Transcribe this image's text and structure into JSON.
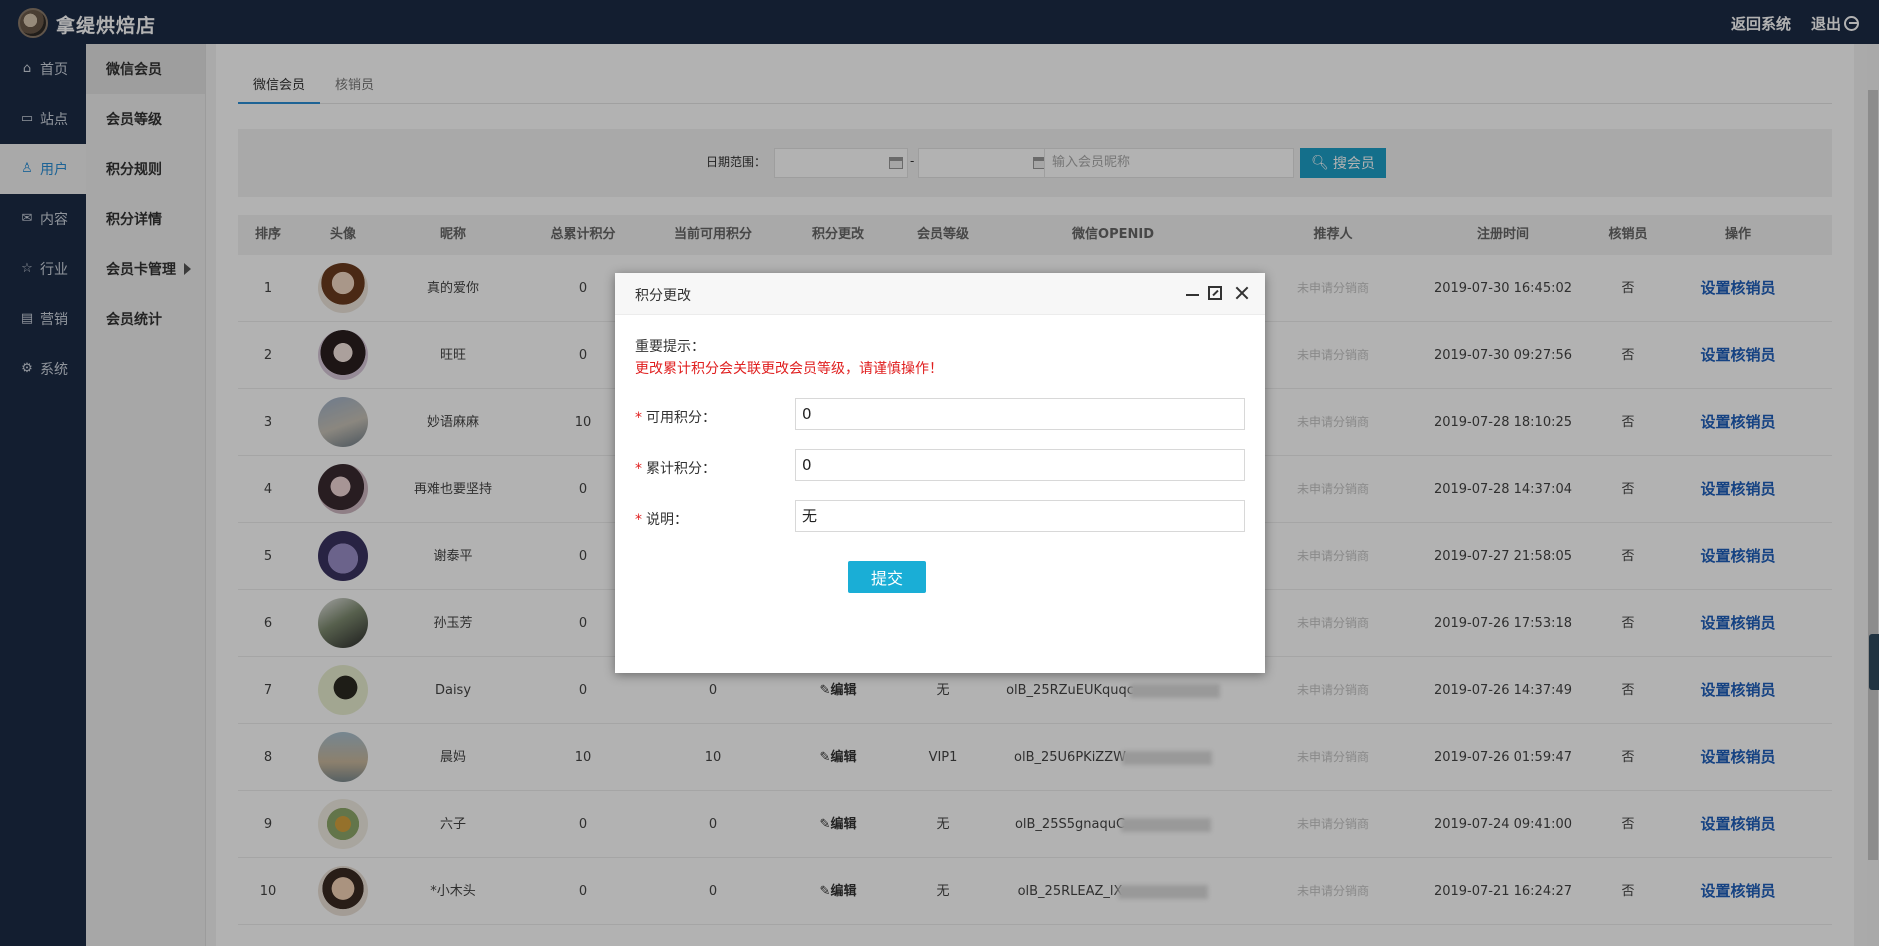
{
  "app": {
    "brand": "拿缇烘焙店",
    "back_label": "返回系统",
    "logout_label": "退出"
  },
  "nav_primary": [
    {
      "label": "首页",
      "icon": "⌂",
      "active": false
    },
    {
      "label": "站点",
      "icon": "▭",
      "active": false
    },
    {
      "label": "用户",
      "icon": "♙",
      "active": true
    },
    {
      "label": "内容",
      "icon": "✉",
      "active": false
    },
    {
      "label": "行业",
      "icon": "☆",
      "active": false
    },
    {
      "label": "营销",
      "icon": "▤",
      "active": false
    },
    {
      "label": "系统",
      "icon": "⚙",
      "active": false
    }
  ],
  "nav_secondary": [
    {
      "label": "微信会员",
      "active": true
    },
    {
      "label": "会员等级",
      "active": false
    },
    {
      "label": "积分规则",
      "active": false
    },
    {
      "label": "积分详情",
      "active": false
    },
    {
      "label": "会员卡管理",
      "active": false
    },
    {
      "label": "会员统计",
      "active": false
    }
  ],
  "tabs": [
    {
      "label": "微信会员"
    },
    {
      "label": "核销员"
    }
  ],
  "filter": {
    "date_label": "日期范围：",
    "dash": "-",
    "search_placeholder": "输入会员昵称",
    "search_button": "搜会员"
  },
  "table": {
    "headers": [
      "排序",
      "头像",
      "昵称",
      "总累计积分",
      "当前可用积分",
      "积分更改",
      "会员等级",
      "微信OPENID",
      "推荐人",
      "注册时间",
      "核销员",
      "操作"
    ],
    "rows": [
      {
        "index": "1",
        "nickname": "真的爱你",
        "total": "0",
        "available": "",
        "edit": "",
        "level": "",
        "openid": "",
        "referrer": "未申请分销商",
        "reg_time": "2019-07-30 16:45:02",
        "verifier": "否",
        "action": "设置核销员"
      },
      {
        "index": "2",
        "nickname": "旺旺",
        "total": "0",
        "available": "",
        "edit": "",
        "level": "",
        "openid": "",
        "referrer": "未申请分销商",
        "reg_time": "2019-07-30 09:27:56",
        "verifier": "否",
        "action": "设置核销员"
      },
      {
        "index": "3",
        "nickname": "妙语麻麻",
        "total": "10",
        "available": "",
        "edit": "",
        "level": "",
        "openid": "",
        "referrer": "未申请分销商",
        "reg_time": "2019-07-28 18:10:25",
        "verifier": "否",
        "action": "设置核销员"
      },
      {
        "index": "4",
        "nickname": "再难也要坚持",
        "total": "0",
        "available": "",
        "edit": "",
        "level": "",
        "openid": "",
        "referrer": "未申请分销商",
        "reg_time": "2019-07-28 14:37:04",
        "verifier": "否",
        "action": "设置核销员"
      },
      {
        "index": "5",
        "nickname": "谢泰平",
        "total": "0",
        "available": "",
        "edit": "",
        "level": "",
        "openid": "",
        "referrer": "未申请分销商",
        "reg_time": "2019-07-27 21:58:05",
        "verifier": "否",
        "action": "设置核销员"
      },
      {
        "index": "6",
        "nickname": "孙玉芳",
        "total": "0",
        "available": "",
        "edit": "",
        "level": "",
        "openid": "",
        "referrer": "未申请分销商",
        "reg_time": "2019-07-26 17:53:18",
        "verifier": "否",
        "action": "设置核销员"
      },
      {
        "index": "7",
        "nickname": "Daisy",
        "total": "0",
        "available": "0",
        "edit": "编辑",
        "level": "无",
        "openid": "olB_25RZuEUKquqc",
        "referrer": "未申请分销商",
        "reg_time": "2019-07-26 14:37:49",
        "verifier": "否",
        "action": "设置核销员"
      },
      {
        "index": "8",
        "nickname": "晨妈",
        "total": "10",
        "available": "10",
        "edit": "编辑",
        "level": "VIP1",
        "openid": "olB_25U6PKiZZW",
        "referrer": "未申请分销商",
        "reg_time": "2019-07-26 01:59:47",
        "verifier": "否",
        "action": "设置核销员"
      },
      {
        "index": "9",
        "nickname": "六子",
        "total": "0",
        "available": "0",
        "edit": "编辑",
        "level": "无",
        "openid": "olB_25S5gnaquC",
        "referrer": "未申请分销商",
        "reg_time": "2019-07-24 09:41:00",
        "verifier": "否",
        "action": "设置核销员"
      },
      {
        "index": "10",
        "nickname": "*小木头",
        "total": "0",
        "available": "0",
        "edit": "编辑",
        "level": "无",
        "openid": "olB_25RLEAZ_lX",
        "referrer": "未申请分销商",
        "reg_time": "2019-07-21 16:24:27",
        "verifier": "否",
        "action": "设置核销员"
      }
    ]
  },
  "modal": {
    "title": "积分更改",
    "notice_title": "重要提示：",
    "notice_text": "更改累计积分会关联更改会员等级，请谨慎操作！",
    "fields": [
      {
        "label": "可用积分：",
        "value": "0"
      },
      {
        "label": "累计积分：",
        "value": "0"
      },
      {
        "label": "说明：",
        "value": "无"
      }
    ],
    "submit_label": "提交"
  },
  "colors": {
    "sidebar": "#1c2b45",
    "accent": "#1aaed6",
    "link": "#1f5fbb",
    "warning": "#e02020"
  }
}
